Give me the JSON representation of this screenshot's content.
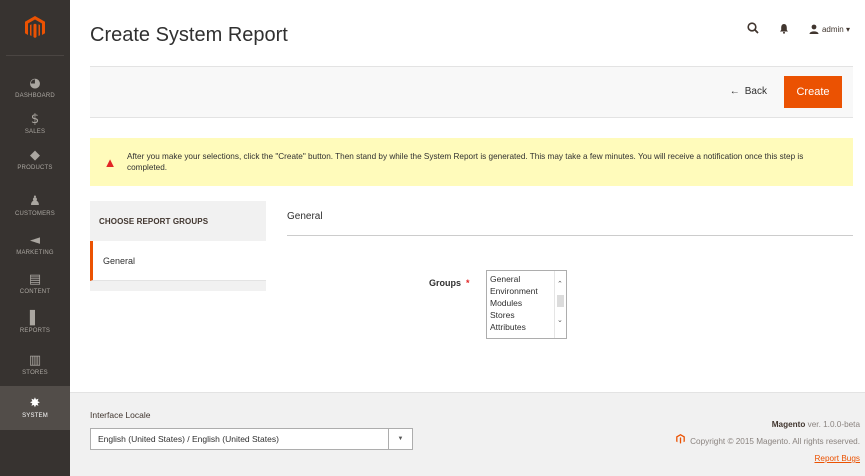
{
  "header": {
    "title": "Create System Report",
    "admin_label": "admin ▾"
  },
  "sidebar": {
    "items": [
      {
        "label": "Dashboard",
        "icon": "dashboard-icon",
        "glyph": "◕"
      },
      {
        "label": "Sales",
        "icon": "dollar-icon",
        "glyph": "$"
      },
      {
        "label": "Products",
        "icon": "box-icon",
        "glyph": "◆"
      },
      {
        "label": "Customers",
        "icon": "person-icon",
        "glyph": "♟"
      },
      {
        "label": "Marketing",
        "icon": "megaphone-icon",
        "glyph": "◄"
      },
      {
        "label": "Content",
        "icon": "layout-icon",
        "glyph": "▤"
      },
      {
        "label": "Reports",
        "icon": "bar-chart-icon",
        "glyph": "▌"
      },
      {
        "label": "Stores",
        "icon": "store-icon",
        "glyph": "▥"
      },
      {
        "label": "System",
        "icon": "gear-icon",
        "glyph": "✸"
      }
    ]
  },
  "actions": {
    "back_label": "Back",
    "create_label": "Create"
  },
  "notice": {
    "text": "After you make your selections, click the \"Create\" button. Then stand by while the System Report is generated. This may take a few minutes. You will receive a notification once this step is completed."
  },
  "tabs": {
    "heading": "CHOOSE REPORT GROUPS",
    "items": [
      "General"
    ]
  },
  "form": {
    "section_title": "General",
    "groups_label": "Groups",
    "required_mark": "*",
    "group_options": [
      "General",
      "Environment",
      "Modules",
      "Stores",
      "Attributes"
    ]
  },
  "footer": {
    "locale_label": "Interface Locale",
    "locale_value": "English (United States) / English (United States)",
    "brand": "Magento",
    "version": "ver. 1.0.0-beta",
    "copyright": "Copyright © 2015 Magento. All rights reserved.",
    "report_bugs": "Report Bugs"
  },
  "colors": {
    "accent": "#eb5202",
    "sidebar": "#373330",
    "notice_bg": "#fffbbb"
  }
}
